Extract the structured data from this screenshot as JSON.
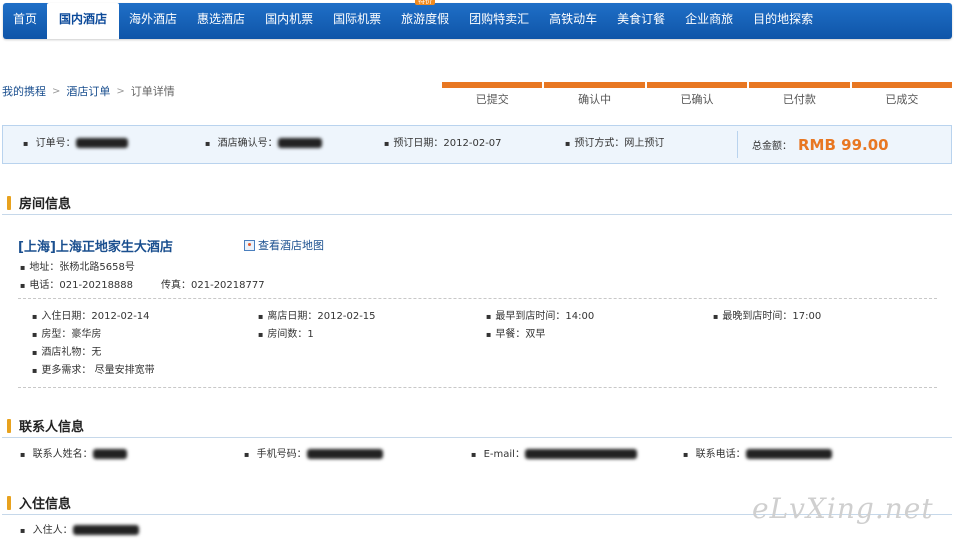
{
  "nav": {
    "items": [
      "首页",
      "国内酒店",
      "海外酒店",
      "惠选酒店",
      "国内机票",
      "国际机票",
      "旅游度假",
      "团购特卖汇",
      "高铁动车",
      "美食订餐",
      "企业商旅",
      "目的地探索"
    ],
    "badge": "特价"
  },
  "breadcrumb": {
    "home": "我的携程",
    "orders": "酒店订单",
    "current": "订单详情"
  },
  "progress": [
    "已提交",
    "确认中",
    "已确认",
    "已付款",
    "已成交"
  ],
  "summary": {
    "order_no_label": "订单号：",
    "confirm_no_label": "酒店确认号：",
    "book_date": "预订日期：2012-02-07",
    "book_method": "预订方式：网上预订",
    "total_label": "总金额：",
    "total_amount": "RMB 99.00"
  },
  "room": {
    "section_title": "房间信息",
    "hotel_name": "[上海]上海正地家生大酒店",
    "map_link": "查看酒店地图",
    "address": "地址：张杨北路5658号",
    "phone": "电话：021-20218888",
    "fax": "传真：021-20218777",
    "checkin": "入住日期：2012-02-14",
    "checkout": "离店日期：2012-02-15",
    "earliest": "最早到店时间：14:00",
    "latest": "最晚到店时间：17:00",
    "room_type": "房型：豪华房",
    "room_count": "房间数：1",
    "breakfast": "早餐：双早",
    "gift": "酒店礼物：无",
    "more": "更多需求：  尽量安排宽带"
  },
  "contact": {
    "section_title": "联系人信息",
    "name_label": "联系人姓名：",
    "mobile_label": "手机号码：",
    "email_label": "E-mail：",
    "tel_label": "联系电话："
  },
  "guest": {
    "section_title": "入住信息",
    "guest_label": "入住人："
  },
  "watermark": "eLvXing.net"
}
